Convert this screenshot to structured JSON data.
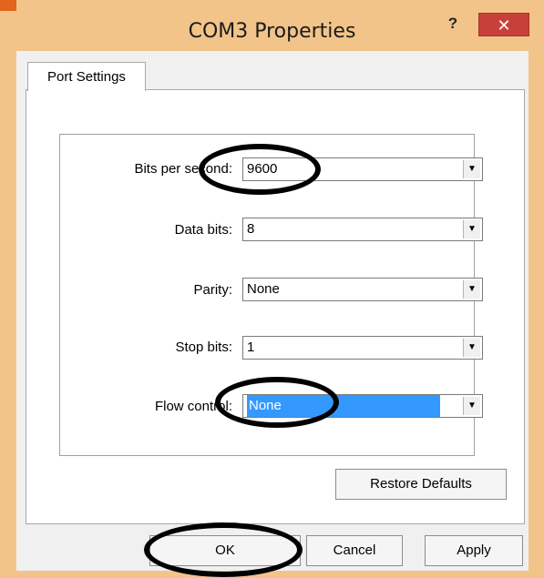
{
  "window": {
    "title": "COM3 Properties",
    "help_label": "?",
    "close_label": "✕"
  },
  "tab": {
    "label": "Port Settings"
  },
  "settings": [
    {
      "label": "Bits per second:",
      "value": "9600"
    },
    {
      "label": "Data bits:",
      "value": "8"
    },
    {
      "label": "Parity:",
      "value": "None"
    },
    {
      "label": "Stop bits:",
      "value": "1"
    },
    {
      "label": "Flow control:",
      "value": "None"
    }
  ],
  "buttons": {
    "restore_defaults": "Restore Defaults",
    "ok": "OK",
    "cancel": "Cancel",
    "apply": "Apply"
  },
  "dropdown_arrow": "▼",
  "colors": {
    "title_bar": "#f2c48a",
    "close_button": "#c7413a",
    "selection": "#3399ff",
    "annotation": "#000000"
  }
}
